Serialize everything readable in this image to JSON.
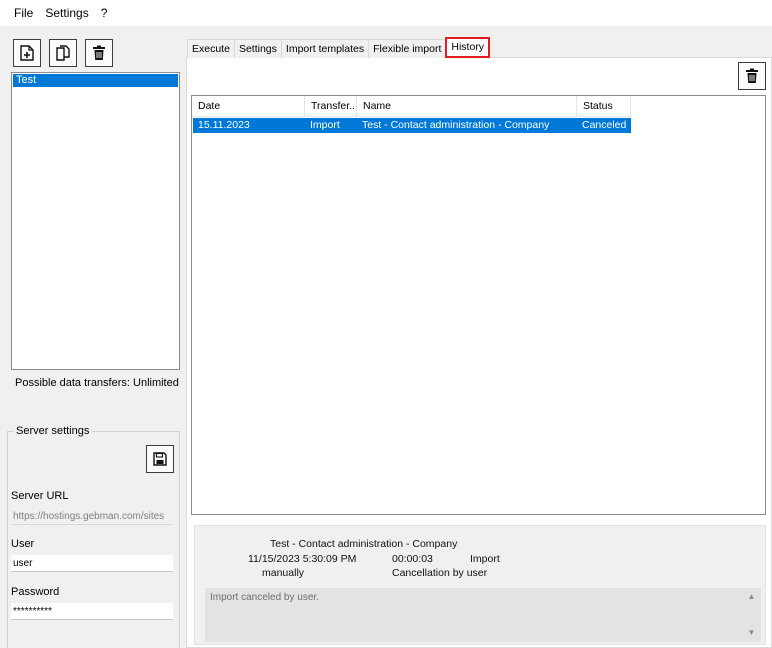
{
  "menu": {
    "file": "File",
    "settings": "Settings",
    "help": "?"
  },
  "toolbar": {
    "new_icon": "new-document-icon",
    "copy_icon": "copy-document-icon",
    "delete_icon": "trash-icon"
  },
  "profiles": {
    "items": [
      "Test"
    ],
    "selected": "Test"
  },
  "possible_transfers": "Possible data transfers: Unlimited",
  "server_settings": {
    "legend": "Server settings",
    "save_icon": "floppy-disk-icon",
    "url_label": "Server URL",
    "url_value": "https://hostings.gebman.com/sites",
    "user_label": "User",
    "user_value": "user",
    "password_label": "Password",
    "password_value": "**********"
  },
  "tabs": [
    {
      "label": "Execute"
    },
    {
      "label": "Settings"
    },
    {
      "label": "Import templates"
    },
    {
      "label": "Flexible import"
    },
    {
      "label": "History",
      "active": true
    }
  ],
  "history": {
    "delete_icon": "trash-icon",
    "columns": [
      "Date",
      "Transfer...",
      "Name",
      "Status"
    ],
    "rows": [
      {
        "date": "15.11.2023",
        "transfer": "Import",
        "name": "Test - Contact administration - Company",
        "status": "Canceled"
      }
    ],
    "detail": {
      "name": "Test - Contact administration - Company",
      "timestamp": "11/15/2023 5:30:09 PM",
      "duration": "00:00:03",
      "type": "Import",
      "trigger": "manually",
      "reason": "Cancellation by user",
      "log": "Import canceled by user."
    }
  },
  "colors": {
    "selection": "#0078d7",
    "highlight_border": "#e01e1e"
  }
}
